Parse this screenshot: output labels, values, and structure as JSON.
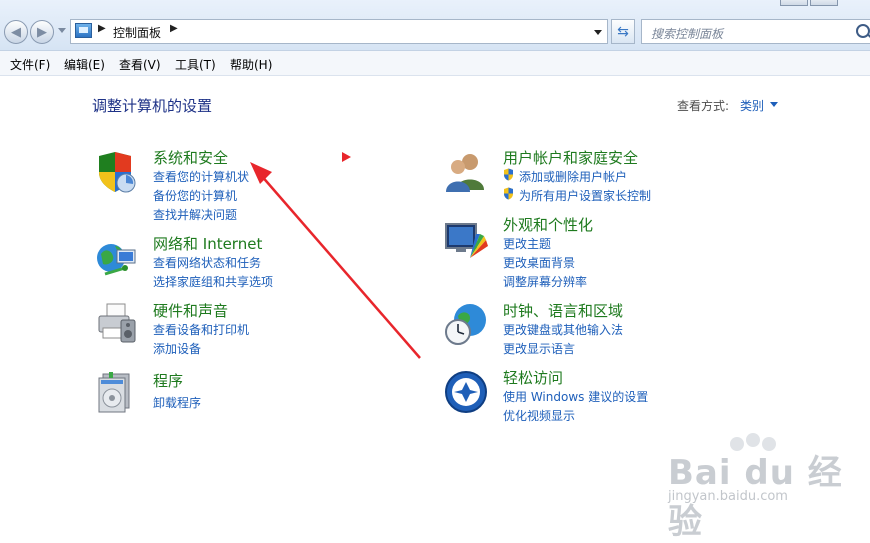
{
  "address": {
    "crumb": "控制面板"
  },
  "search": {
    "placeholder": "搜索控制面板"
  },
  "menu": [
    "文件(F)",
    "编辑(E)",
    "查看(V)",
    "工具(T)",
    "帮助(H)"
  ],
  "page_title": "调整计算机的设置",
  "view_by": {
    "label": "查看方式:",
    "value": "类别"
  },
  "categories": [
    {
      "title": "系统和安全",
      "icon": "shield-icon",
      "links": [
        "查看您的计算机状",
        "备份您的计算机",
        "查找并解决问题"
      ]
    },
    {
      "title": "网络和 Internet",
      "icon": "network-globe-icon",
      "links": [
        "查看网络状态和任务",
        "选择家庭组和共享选项"
      ]
    },
    {
      "title": "硬件和声音",
      "icon": "printer-icon",
      "links": [
        "查看设备和打印机",
        "添加设备"
      ]
    },
    {
      "title": "程序",
      "icon": "programs-icon",
      "links": [
        "卸载程序"
      ]
    },
    {
      "title": "用户帐户和家庭安全",
      "icon": "users-icon",
      "links": [
        "添加或删除用户帐户",
        "为所有用户设置家长控制"
      ]
    },
    {
      "title": "外观和个性化",
      "icon": "monitor-palette-icon",
      "links": [
        "更改主题",
        "更改桌面背景",
        "调整屏幕分辨率"
      ]
    },
    {
      "title": "时钟、语言和区域",
      "icon": "clock-globe-icon",
      "links": [
        "更改键盘或其他输入法",
        "更改显示语言"
      ]
    },
    {
      "title": "轻松访问",
      "icon": "ease-of-access-icon",
      "links": [
        "使用 Windows 建议的设置",
        "优化视频显示"
      ]
    }
  ],
  "watermark": {
    "brand": "Bai du 经验",
    "url": "jingyan.baidu.com"
  },
  "colors": {
    "category_title": "#1e7a1e",
    "link": "#1e5fba",
    "heading": "#1e3287",
    "annotation": "#e8262c"
  }
}
